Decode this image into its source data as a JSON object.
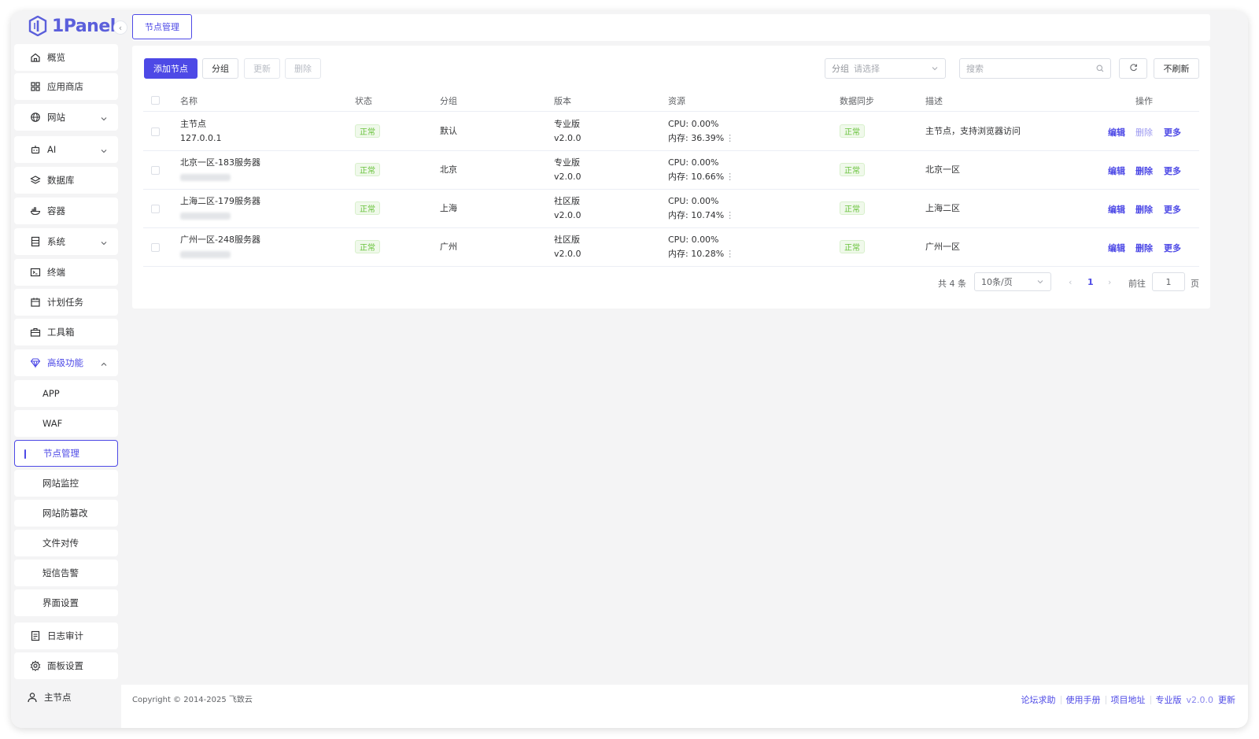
{
  "app": {
    "logo_text": "1Panel"
  },
  "sidebar": {
    "items": [
      {
        "label": "概览",
        "icon": "home-icon"
      },
      {
        "label": "应用商店",
        "icon": "grid-icon"
      },
      {
        "label": "网站",
        "icon": "globe-icon"
      },
      {
        "label": "AI",
        "icon": "robot-icon"
      },
      {
        "label": "数据库",
        "icon": "layers-icon"
      },
      {
        "label": "容器",
        "icon": "docker-icon"
      },
      {
        "label": "系统",
        "icon": "server-icon"
      },
      {
        "label": "终端",
        "icon": "terminal-icon"
      },
      {
        "label": "计划任务",
        "icon": "calendar-icon"
      },
      {
        "label": "工具箱",
        "icon": "toolbox-icon"
      },
      {
        "label": "高级功能",
        "icon": "diamond-icon"
      }
    ],
    "sub_items": [
      "APP",
      "WAF",
      "节点管理",
      "网站监控",
      "网站防篡改",
      "文件对传",
      "短信告警",
      "界面设置"
    ],
    "bottom_items": [
      {
        "label": "日志审计",
        "icon": "log-icon"
      },
      {
        "label": "面板设置",
        "icon": "gear-icon"
      }
    ],
    "user": "主节点"
  },
  "tabs": {
    "active": "节点管理"
  },
  "toolbar": {
    "add_label": "添加节点",
    "group_label": "分组",
    "update_label": "更新",
    "delete_label": "删除",
    "group_select_prefix": "分组",
    "group_select_placeholder": "请选择",
    "search_placeholder": "搜索",
    "no_refresh_label": "不刷新"
  },
  "table": {
    "headers": [
      "名称",
      "状态",
      "分组",
      "版本",
      "资源",
      "数据同步",
      "描述",
      "操作"
    ],
    "rows": [
      {
        "name": "主节点",
        "address": "127.0.0.1",
        "status": "正常",
        "group": "默认",
        "edition": "专业版",
        "version": "v2.0.0",
        "cpu": "CPU: 0.00%",
        "mem": "内存: 36.39%",
        "sync": "正常",
        "desc": "主节点，支持浏览器访问",
        "edit": "编辑",
        "delete": "删除",
        "more": "更多"
      },
      {
        "name": "北京一区-183服务器",
        "address": "",
        "status": "正常",
        "group": "北京",
        "edition": "专业版",
        "version": "v2.0.0",
        "cpu": "CPU: 0.00%",
        "mem": "内存: 10.66%",
        "sync": "正常",
        "desc": "北京一区",
        "edit": "编辑",
        "delete": "删除",
        "more": "更多"
      },
      {
        "name": "上海二区-179服务器",
        "address": "",
        "status": "正常",
        "group": "上海",
        "edition": "社区版",
        "version": "v2.0.0",
        "cpu": "CPU: 0.00%",
        "mem": "内存: 10.74%",
        "sync": "正常",
        "desc": "上海二区",
        "edit": "编辑",
        "delete": "删除",
        "more": "更多"
      },
      {
        "name": "广州一区-248服务器",
        "address": "",
        "status": "正常",
        "group": "广州",
        "edition": "社区版",
        "version": "v2.0.0",
        "cpu": "CPU: 0.00%",
        "mem": "内存: 10.28%",
        "sync": "正常",
        "desc": "广州一区",
        "edit": "编辑",
        "delete": "删除",
        "more": "更多"
      }
    ]
  },
  "pagination": {
    "total": "共 4 条",
    "page_size": "10条/页",
    "current_page": "1",
    "goto_label": "前往",
    "goto_value": "1",
    "page_suffix": "页"
  },
  "footer": {
    "copyright": "Copyright © 2014-2025 飞致云",
    "links": [
      "论坛求助",
      "使用手册",
      "项目地址"
    ],
    "edition": "专业版",
    "version": "v2.0.0",
    "update": "更新"
  },
  "colors": {
    "accent": "#4d49e6",
    "success": "#67c23a",
    "background": "#f4f4f5"
  }
}
